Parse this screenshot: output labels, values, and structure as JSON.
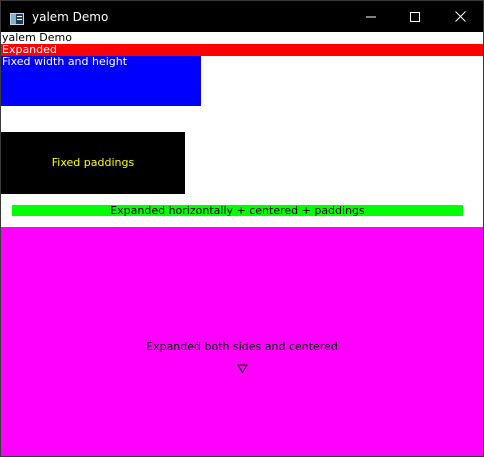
{
  "window": {
    "title": "yalem Demo",
    "icon": "app-window-icon",
    "controls": [
      "minimize-icon",
      "maximize-icon",
      "close-icon"
    ]
  },
  "content": {
    "app_label": "yalem Demo",
    "expanded_label": "Expanded",
    "fixed_label": "Fixed width and height",
    "paddings_label": "Fixed paddings",
    "horizontal_label": "Expanded horizontally + centered + paddings",
    "both_label": "Expanded both sides and centered",
    "marker_icon": "triangle-down-outline-icon"
  },
  "colors": {
    "titlebar": "#000000",
    "expanded_bar": "#ff0000",
    "fixed_box": "#0000ff",
    "paddings_box": "#000000",
    "paddings_text": "#ffff00",
    "green_bar": "#00ff00",
    "magenta_box": "#ff00ff"
  }
}
